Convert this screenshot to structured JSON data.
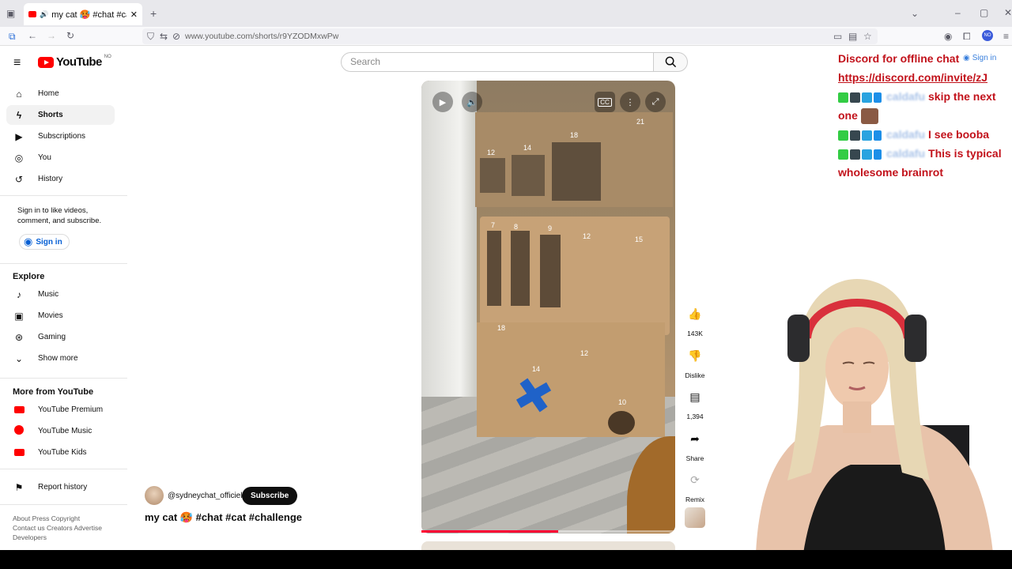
{
  "browser": {
    "tab_title": "my cat 🥵 #chat #cat #cha",
    "url": "www.youtube.com/shorts/r9YZODMxwPw",
    "profile_badge": "NO"
  },
  "header": {
    "logo_text": "YouTube",
    "region": "NO",
    "search_placeholder": "Search",
    "signin_label": "Sign in"
  },
  "sidebar": {
    "main": [
      {
        "label": "Home",
        "icon": "home-icon"
      },
      {
        "label": "Shorts",
        "icon": "shorts-icon"
      },
      {
        "label": "Subscriptions",
        "icon": "subscriptions-icon"
      },
      {
        "label": "You",
        "icon": "you-icon"
      },
      {
        "label": "History",
        "icon": "history-icon"
      }
    ],
    "signin_prompt": "Sign in to like videos, comment, and subscribe.",
    "signin_label": "Sign in",
    "explore_heading": "Explore",
    "explore": [
      {
        "label": "Music",
        "icon": "music-icon"
      },
      {
        "label": "Movies",
        "icon": "movies-icon"
      },
      {
        "label": "Gaming",
        "icon": "gaming-icon"
      },
      {
        "label": "Show more",
        "icon": "chevron-down-icon"
      }
    ],
    "more_heading": "More from YouTube",
    "more": [
      {
        "label": "YouTube Premium"
      },
      {
        "label": "YouTube Music"
      },
      {
        "label": "YouTube Kids"
      }
    ],
    "report_history": "Report history",
    "footer": {
      "line1": [
        "About",
        "Press",
        "Copyright"
      ],
      "line2": [
        "Contact us",
        "Creators",
        "Advertise"
      ],
      "line3": [
        "Developers"
      ]
    }
  },
  "short": {
    "channel": "@sydneychat_officiel",
    "subscribe_label": "Subscribe",
    "title": "my cat 🥵 #chat #cat #challenge",
    "progress": 0.54,
    "actions": {
      "likes": "143K",
      "dislike": "Dislike",
      "comments": "1,394",
      "share": "Share",
      "remix": "Remix"
    },
    "board_numbers": [
      "12",
      "14",
      "18",
      "21",
      "7",
      "8",
      "9",
      "12",
      "15",
      "18",
      "12",
      "14",
      "10"
    ]
  },
  "overlay_chat": {
    "promo": "Discord for offline chat",
    "link": "https://discord.com/invite/zJ",
    "messages": [
      "skip the next one",
      "I see booba",
      "This is typical wholesome brainrot"
    ]
  },
  "colors": {
    "yt_red": "#ff0000",
    "chat_red": "#c2121b",
    "link_blue": "#065fd4"
  }
}
